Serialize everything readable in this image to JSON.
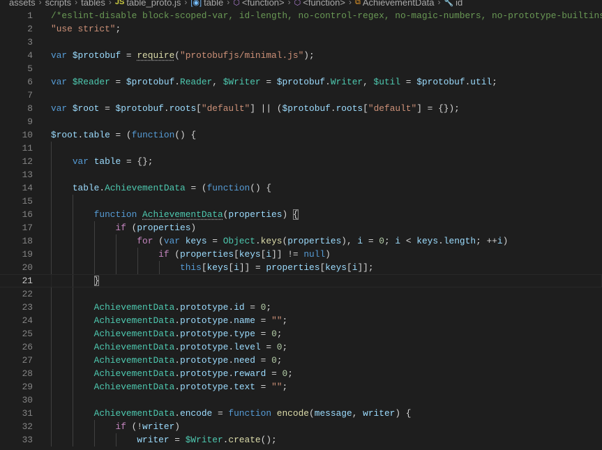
{
  "breadcrumb": [
    {
      "label": "assets",
      "icon": ""
    },
    {
      "label": "scripts",
      "icon": ""
    },
    {
      "label": "tables",
      "icon": ""
    },
    {
      "label": "table_proto.js",
      "icon": "js-file-icon",
      "glyph": "JS",
      "color": "#cbcb41"
    },
    {
      "label": "table",
      "icon": "variable-icon",
      "glyph": "[◉]",
      "color": "#75beff"
    },
    {
      "label": "<function>",
      "icon": "method-cube-icon",
      "glyph": "⬡",
      "color": "#b180d7"
    },
    {
      "label": "<function>",
      "icon": "method-cube-icon",
      "glyph": "⬡",
      "color": "#b180d7"
    },
    {
      "label": "AchievementData",
      "icon": "class-icon",
      "glyph": "⧉",
      "color": "#ee9d28"
    },
    {
      "label": "id",
      "icon": "property-wrench-icon",
      "glyph": "🔧",
      "color": "#cccccc"
    }
  ],
  "editor": {
    "current_line": 21,
    "lines": [
      {
        "n": "1",
        "g": 0,
        "t": [
          [
            "m",
            "/*eslint-disable block-scoped-var, id-length, no-control-regex, no-magic-numbers, no-prototype-builtins"
          ]
        ]
      },
      {
        "n": "2",
        "g": 0,
        "t": [
          [
            "s",
            "\"use strict\""
          ],
          [
            "p",
            ";"
          ]
        ]
      },
      {
        "n": "3",
        "g": 0,
        "t": []
      },
      {
        "n": "4",
        "g": 0,
        "t": [
          [
            "k",
            "var "
          ],
          [
            "v",
            "$protobuf"
          ],
          [
            "p",
            " = "
          ],
          [
            "f dots",
            "require"
          ],
          [
            "p",
            "("
          ],
          [
            "s",
            "\"protobufjs/minimal.js\""
          ],
          [
            "p",
            ");"
          ]
        ]
      },
      {
        "n": "5",
        "g": 0,
        "t": []
      },
      {
        "n": "6",
        "g": 0,
        "t": [
          [
            "k",
            "var "
          ],
          [
            "t",
            "$Reader"
          ],
          [
            "p",
            " = "
          ],
          [
            "v",
            "$protobuf"
          ],
          [
            "p",
            "."
          ],
          [
            "t",
            "Reader"
          ],
          [
            "p",
            ", "
          ],
          [
            "t",
            "$Writer"
          ],
          [
            "p",
            " = "
          ],
          [
            "v",
            "$protobuf"
          ],
          [
            "p",
            "."
          ],
          [
            "t",
            "Writer"
          ],
          [
            "p",
            ", "
          ],
          [
            "t",
            "$util"
          ],
          [
            "p",
            " = "
          ],
          [
            "v",
            "$protobuf"
          ],
          [
            "p",
            "."
          ],
          [
            "v",
            "util"
          ],
          [
            "p",
            ";"
          ]
        ]
      },
      {
        "n": "7",
        "g": 0,
        "t": []
      },
      {
        "n": "8",
        "g": 0,
        "t": [
          [
            "k",
            "var "
          ],
          [
            "v",
            "$root"
          ],
          [
            "p",
            " = "
          ],
          [
            "v",
            "$protobuf"
          ],
          [
            "p",
            "."
          ],
          [
            "v",
            "roots"
          ],
          [
            "p",
            "["
          ],
          [
            "s",
            "\"default\""
          ],
          [
            "p",
            "] || ("
          ],
          [
            "v",
            "$protobuf"
          ],
          [
            "p",
            "."
          ],
          [
            "v",
            "roots"
          ],
          [
            "p",
            "["
          ],
          [
            "s",
            "\"default\""
          ],
          [
            "p",
            "] = {});"
          ]
        ]
      },
      {
        "n": "9",
        "g": 0,
        "t": []
      },
      {
        "n": "10",
        "g": 0,
        "t": [
          [
            "v",
            "$root"
          ],
          [
            "p",
            "."
          ],
          [
            "v",
            "table"
          ],
          [
            "p",
            " = ("
          ],
          [
            "k",
            "function"
          ],
          [
            "p",
            "() {"
          ]
        ]
      },
      {
        "n": "11",
        "g": 1,
        "t": []
      },
      {
        "n": "12",
        "g": 1,
        "t": [
          [
            "p",
            "    "
          ],
          [
            "k",
            "var "
          ],
          [
            "v",
            "table"
          ],
          [
            "p",
            " = {};"
          ]
        ]
      },
      {
        "n": "13",
        "g": 1,
        "t": []
      },
      {
        "n": "14",
        "g": 1,
        "t": [
          [
            "p",
            "    "
          ],
          [
            "v",
            "table"
          ],
          [
            "p",
            "."
          ],
          [
            "t",
            "AchievementData"
          ],
          [
            "p",
            " = ("
          ],
          [
            "k",
            "function"
          ],
          [
            "p",
            "() {"
          ]
        ]
      },
      {
        "n": "15",
        "g": 2,
        "t": []
      },
      {
        "n": "16",
        "g": 2,
        "t": [
          [
            "p",
            "        "
          ],
          [
            "k",
            "function "
          ],
          [
            "t dots",
            "AchievementData"
          ],
          [
            "p",
            "("
          ],
          [
            "v",
            "properties"
          ],
          [
            "p",
            ") "
          ],
          [
            "pb",
            "{"
          ]
        ]
      },
      {
        "n": "17",
        "g": 3,
        "t": [
          [
            "p",
            "            "
          ],
          [
            "c",
            "if"
          ],
          [
            "p",
            " ("
          ],
          [
            "v",
            "properties"
          ],
          [
            "p",
            ")"
          ]
        ]
      },
      {
        "n": "18",
        "g": 4,
        "t": [
          [
            "p",
            "                "
          ],
          [
            "c",
            "for"
          ],
          [
            "p",
            " ("
          ],
          [
            "k",
            "var "
          ],
          [
            "v",
            "keys"
          ],
          [
            "p",
            " = "
          ],
          [
            "t",
            "Object"
          ],
          [
            "p",
            "."
          ],
          [
            "f",
            "keys"
          ],
          [
            "p",
            "("
          ],
          [
            "v",
            "properties"
          ],
          [
            "p",
            "), "
          ],
          [
            "v",
            "i"
          ],
          [
            "p",
            " = "
          ],
          [
            "n",
            "0"
          ],
          [
            "p",
            "; "
          ],
          [
            "v",
            "i"
          ],
          [
            "p",
            " < "
          ],
          [
            "v",
            "keys"
          ],
          [
            "p",
            "."
          ],
          [
            "v",
            "length"
          ],
          [
            "p",
            "; ++"
          ],
          [
            "v",
            "i"
          ],
          [
            "p",
            ")"
          ]
        ]
      },
      {
        "n": "19",
        "g": 5,
        "t": [
          [
            "p",
            "                    "
          ],
          [
            "c",
            "if"
          ],
          [
            "p",
            " ("
          ],
          [
            "v",
            "properties"
          ],
          [
            "p",
            "["
          ],
          [
            "v",
            "keys"
          ],
          [
            "p",
            "["
          ],
          [
            "v",
            "i"
          ],
          [
            "p",
            "]] != "
          ],
          [
            "k",
            "null"
          ],
          [
            "p",
            ")"
          ]
        ]
      },
      {
        "n": "20",
        "g": 6,
        "t": [
          [
            "p",
            "                        "
          ],
          [
            "k",
            "this"
          ],
          [
            "p",
            "["
          ],
          [
            "v",
            "keys"
          ],
          [
            "p",
            "["
          ],
          [
            "v",
            "i"
          ],
          [
            "p",
            "]] = "
          ],
          [
            "v",
            "properties"
          ],
          [
            "p",
            "["
          ],
          [
            "v",
            "keys"
          ],
          [
            "p",
            "["
          ],
          [
            "v",
            "i"
          ],
          [
            "p",
            "]];"
          ]
        ]
      },
      {
        "n": "21",
        "g": 2,
        "t": [
          [
            "p",
            "        "
          ],
          [
            "pb",
            "}"
          ]
        ]
      },
      {
        "n": "22",
        "g": 2,
        "t": []
      },
      {
        "n": "23",
        "g": 2,
        "t": [
          [
            "p",
            "        "
          ],
          [
            "t",
            "AchievementData"
          ],
          [
            "p",
            "."
          ],
          [
            "v",
            "prototype"
          ],
          [
            "p",
            "."
          ],
          [
            "v",
            "id"
          ],
          [
            "p",
            " = "
          ],
          [
            "n",
            "0"
          ],
          [
            "p",
            ";"
          ]
        ]
      },
      {
        "n": "24",
        "g": 2,
        "t": [
          [
            "p",
            "        "
          ],
          [
            "t",
            "AchievementData"
          ],
          [
            "p",
            "."
          ],
          [
            "v",
            "prototype"
          ],
          [
            "p",
            "."
          ],
          [
            "v",
            "name"
          ],
          [
            "p",
            " = "
          ],
          [
            "s",
            "\"\""
          ],
          [
            "p",
            ";"
          ]
        ]
      },
      {
        "n": "25",
        "g": 2,
        "t": [
          [
            "p",
            "        "
          ],
          [
            "t",
            "AchievementData"
          ],
          [
            "p",
            "."
          ],
          [
            "v",
            "prototype"
          ],
          [
            "p",
            "."
          ],
          [
            "v",
            "type"
          ],
          [
            "p",
            " = "
          ],
          [
            "n",
            "0"
          ],
          [
            "p",
            ";"
          ]
        ]
      },
      {
        "n": "26",
        "g": 2,
        "t": [
          [
            "p",
            "        "
          ],
          [
            "t",
            "AchievementData"
          ],
          [
            "p",
            "."
          ],
          [
            "v",
            "prototype"
          ],
          [
            "p",
            "."
          ],
          [
            "v",
            "level"
          ],
          [
            "p",
            " = "
          ],
          [
            "n",
            "0"
          ],
          [
            "p",
            ";"
          ]
        ]
      },
      {
        "n": "27",
        "g": 2,
        "t": [
          [
            "p",
            "        "
          ],
          [
            "t",
            "AchievementData"
          ],
          [
            "p",
            "."
          ],
          [
            "v",
            "prototype"
          ],
          [
            "p",
            "."
          ],
          [
            "v",
            "need"
          ],
          [
            "p",
            " = "
          ],
          [
            "n",
            "0"
          ],
          [
            "p",
            ";"
          ]
        ]
      },
      {
        "n": "28",
        "g": 2,
        "t": [
          [
            "p",
            "        "
          ],
          [
            "t",
            "AchievementData"
          ],
          [
            "p",
            "."
          ],
          [
            "v",
            "prototype"
          ],
          [
            "p",
            "."
          ],
          [
            "v",
            "reward"
          ],
          [
            "p",
            " = "
          ],
          [
            "n",
            "0"
          ],
          [
            "p",
            ";"
          ]
        ]
      },
      {
        "n": "29",
        "g": 2,
        "t": [
          [
            "p",
            "        "
          ],
          [
            "t",
            "AchievementData"
          ],
          [
            "p",
            "."
          ],
          [
            "v",
            "prototype"
          ],
          [
            "p",
            "."
          ],
          [
            "v",
            "text"
          ],
          [
            "p",
            " = "
          ],
          [
            "s",
            "\"\""
          ],
          [
            "p",
            ";"
          ]
        ]
      },
      {
        "n": "30",
        "g": 2,
        "t": []
      },
      {
        "n": "31",
        "g": 2,
        "t": [
          [
            "p",
            "        "
          ],
          [
            "t",
            "AchievementData"
          ],
          [
            "p",
            "."
          ],
          [
            "v",
            "encode"
          ],
          [
            "p",
            " = "
          ],
          [
            "k",
            "function "
          ],
          [
            "f",
            "encode"
          ],
          [
            "p",
            "("
          ],
          [
            "v",
            "message"
          ],
          [
            "p",
            ", "
          ],
          [
            "v",
            "writer"
          ],
          [
            "p",
            ") {"
          ]
        ]
      },
      {
        "n": "32",
        "g": 3,
        "t": [
          [
            "p",
            "            "
          ],
          [
            "c",
            "if"
          ],
          [
            "p",
            " (!"
          ],
          [
            "v",
            "writer"
          ],
          [
            "p",
            ")"
          ]
        ]
      },
      {
        "n": "33",
        "g": 4,
        "t": [
          [
            "p",
            "                "
          ],
          [
            "v",
            "writer"
          ],
          [
            "p",
            " = "
          ],
          [
            "t",
            "$Writer"
          ],
          [
            "p",
            "."
          ],
          [
            "f",
            "create"
          ],
          [
            "p",
            "();"
          ]
        ]
      }
    ]
  }
}
